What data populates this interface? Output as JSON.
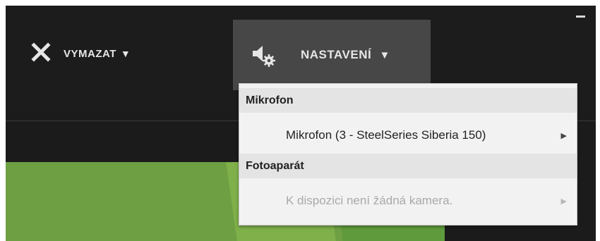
{
  "toolbar": {
    "clear_label": "VYMAZAT",
    "settings_label": "NASTAVENÍ",
    "caret": "▼"
  },
  "menu": {
    "sections": [
      {
        "header": "Mikrofon",
        "items": [
          {
            "label": "Mikrofon (3 - SteelSeries Siberia 150)",
            "enabled": true,
            "has_submenu": true
          }
        ]
      },
      {
        "header": "Fotoaparát",
        "items": [
          {
            "label": "K dispozici není žádná kamera.",
            "enabled": false,
            "has_submenu": true
          }
        ]
      }
    ],
    "submenu_arrow": "▶"
  },
  "icons": {
    "clear": "close-icon",
    "settings": "speaker-gear-icon"
  },
  "colors": {
    "background": "#1c1c1c",
    "settings_button": "#474747",
    "menu_background": "#f2f2f2",
    "menu_header": "#e4e4e4",
    "preview_green": "#6e9f43"
  }
}
